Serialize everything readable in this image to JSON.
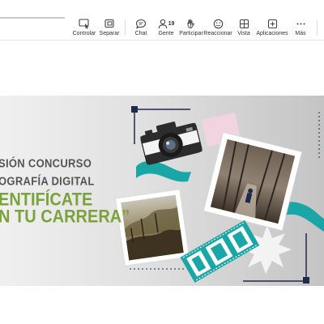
{
  "toolbar": {
    "items": [
      {
        "label": "Controlar",
        "icon": "control-icon"
      },
      {
        "label": "Separar",
        "icon": "separate-icon"
      },
      {
        "label": "Chat",
        "icon": "chat-icon"
      },
      {
        "label": "Gente",
        "icon": "people-icon",
        "count": "19"
      },
      {
        "label": "Participar",
        "icon": "raise-hand-icon"
      },
      {
        "label": "Reaccionar",
        "icon": "smiley-icon"
      },
      {
        "label": "Vista",
        "icon": "grid-icon"
      },
      {
        "label": "Aplicaciones",
        "icon": "add-app-icon"
      },
      {
        "label": "Más",
        "icon": "more-icon"
      }
    ]
  },
  "slide": {
    "line1": "SIÓN CONCURSO",
    "line2": "OGRAFÍA DIGITAL",
    "line3": "ENTIFÍCATE",
    "line4": "N TU CARRERA”",
    "colors": {
      "teal": "#1aa6a6",
      "green": "#7aa33b",
      "gray_text": "#555555",
      "pink": "#f2d4e0",
      "navy": "#1e2a4a"
    }
  }
}
